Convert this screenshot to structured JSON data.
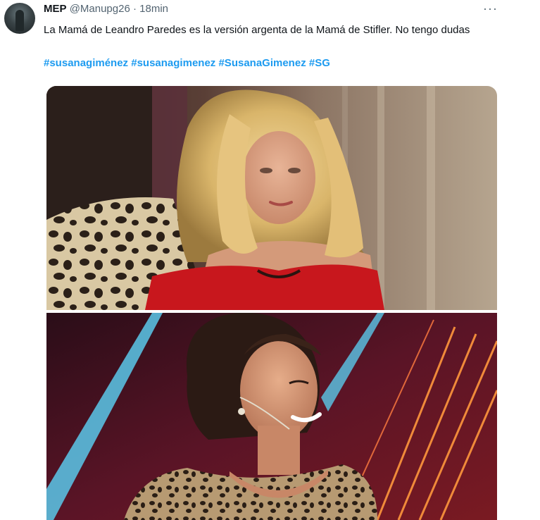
{
  "tweet": {
    "display_name": "MEP",
    "handle": "@Manupg26",
    "separator": "·",
    "time": "18min",
    "more_label": "···",
    "text": "La Mamá de Leandro Paredes es la versión argenta de la Mamá de Stifler. No tengo dudas",
    "hashtags": [
      "#susanagiménez",
      "#susanagimenez",
      "#SusanaGimenez",
      "#SG"
    ]
  },
  "colors": {
    "hashtag": "#1d9bf0",
    "secondary_text": "#536471",
    "primary_text": "#0f1419"
  },
  "icons": {
    "more": "more-options-icon",
    "avatar": "user-avatar"
  },
  "media": {
    "images": [
      "photo-blonde-woman-red-dress",
      "photo-woman-leopard-print-stage"
    ]
  }
}
